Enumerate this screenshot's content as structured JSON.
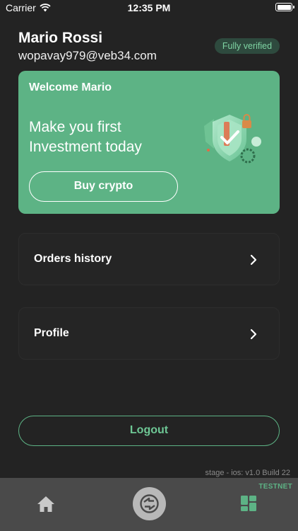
{
  "status_bar": {
    "carrier": "Carrier",
    "time": "12:35 PM",
    "wifi_icon": "wifi-icon",
    "battery_icon": "battery-icon"
  },
  "profile": {
    "name": "Mario Rossi",
    "email": "wopavay979@veb34.com",
    "verification_badge": "Fully verified"
  },
  "welcome_card": {
    "title": "Welcome Mario",
    "text": "Make you first Investment today",
    "button_label": "Buy crypto",
    "illustration": "shield-lock-illustration"
  },
  "menu": [
    {
      "label": "Orders history",
      "icon": "chevron-right-icon"
    },
    {
      "label": "Profile",
      "icon": "chevron-right-icon"
    }
  ],
  "logout_label": "Logout",
  "build_info": "stage - ios: v1.0 Build 22",
  "tab_bar": {
    "network_label": "TESTNET",
    "tabs": [
      {
        "icon": "home-icon"
      },
      {
        "icon": "exchange-icon"
      },
      {
        "icon": "dashboard-icon",
        "active": true
      }
    ]
  },
  "colors": {
    "background": "#232323",
    "accent": "#5db385",
    "card": "#5db385",
    "tab_bar": "#4a4a4a",
    "badge_bg": "#2e4a3e"
  }
}
